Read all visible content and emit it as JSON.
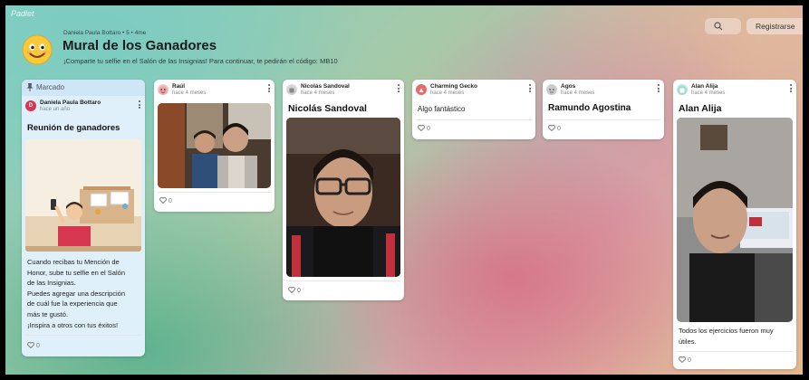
{
  "app": {
    "brand": "Padlet"
  },
  "header": {
    "meta": "Daniela Paula Bottaro • 5 • 4me",
    "title": "Mural de los Ganadores",
    "subtitle": "¡Comparte tu selfie en el Salón de las Insignias! Para continuar, te pedirán el código: MB10",
    "search_icon": "search-icon",
    "register_label": "Registrarse"
  },
  "colors": {
    "accent_red": "#d6364f",
    "pinned_bg": "#dff0fb"
  },
  "pinned": {
    "label": "Marcado",
    "author": "Daniela Paula Bottaro",
    "time": "hace un año",
    "title": "Reunión de ganadores",
    "text_lines": [
      "Cuando recibas tu Mención de",
      "Honor, sube tu selfie en el Salón",
      "de las Insignias.",
      "Puedes agregar una descripción",
      "de cuál fue la experiencia que",
      "más te gustó.",
      "¡Inspira a otros con tus éxitos!"
    ],
    "likes": "0"
  },
  "posts": [
    {
      "author": "Raúl",
      "time": "hace 4 meses",
      "likes": "0"
    },
    {
      "author": "Nicolás Sandoval",
      "time": "hace 4 meses",
      "title": "Nicolás Sandoval",
      "likes": "0"
    },
    {
      "author": "Charming Gecko",
      "time": "hace 4 meses",
      "text": "Algo fantástico",
      "likes": "0"
    },
    {
      "author": "Agos",
      "time": "hace 4 meses",
      "title": "Ramundo Agostina",
      "likes": "0"
    },
    {
      "author": "Alan Alija",
      "time": "hace 4 meses",
      "title": "Alan Alija",
      "text_lines": [
        "Todos los ejercicios fueron muy",
        "útiles."
      ],
      "likes": "0"
    }
  ]
}
